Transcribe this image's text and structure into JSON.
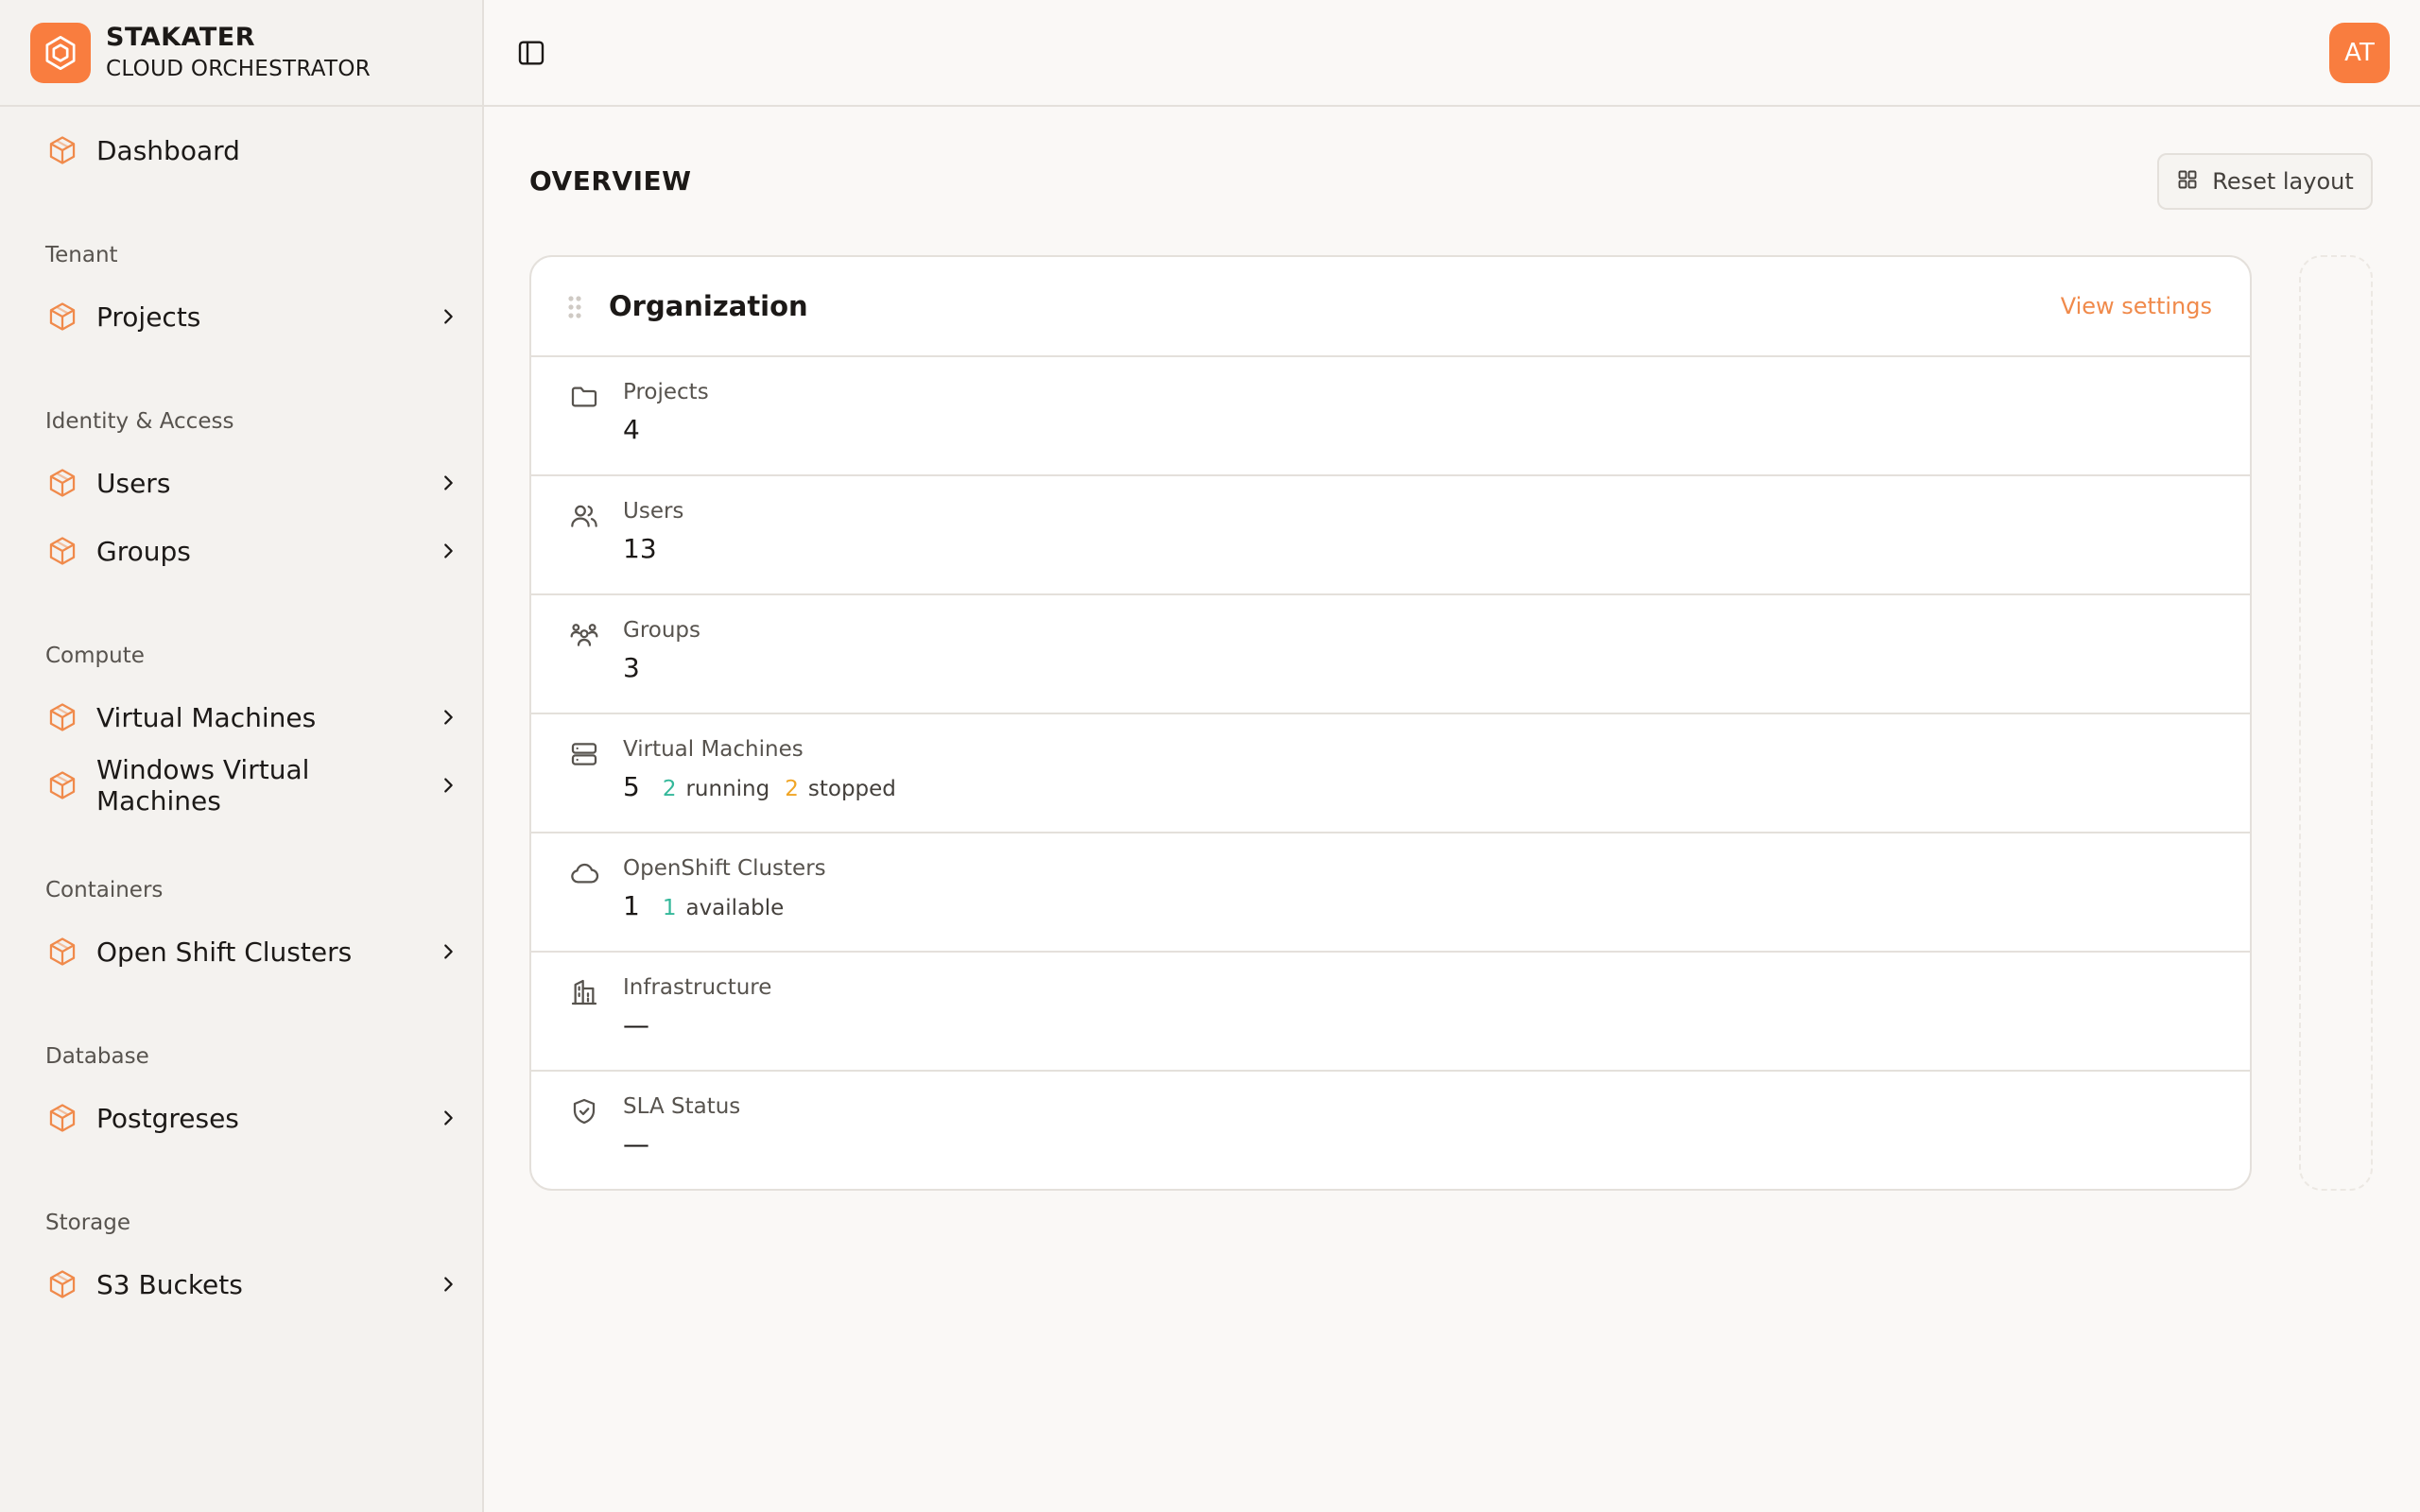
{
  "brand": {
    "name": "STAKATER",
    "subtitle": "CLOUD ORCHESTRATOR"
  },
  "sidebar": {
    "dashboard": "Dashboard",
    "sections": {
      "tenant": "Tenant",
      "identity": "Identity & Access",
      "compute": "Compute",
      "containers": "Containers",
      "database": "Database",
      "storage": "Storage"
    },
    "items": {
      "projects": "Projects",
      "users": "Users",
      "groups": "Groups",
      "virtual_machines": "Virtual Machines",
      "windows_vms": "Windows Virtual Machines",
      "openshift": "Open Shift Clusters",
      "postgreses": "Postgreses",
      "s3": "S3 Buckets"
    }
  },
  "topbar": {
    "avatar_initials": "AT"
  },
  "main": {
    "title": "OVERVIEW",
    "reset_label": "Reset layout",
    "card": {
      "title": "Organization",
      "view_settings": "View settings",
      "rows": {
        "projects": {
          "label": "Projects",
          "value": "4"
        },
        "users": {
          "label": "Users",
          "value": "13"
        },
        "groups": {
          "label": "Groups",
          "value": "3"
        },
        "vms": {
          "label": "Virtual Machines",
          "value": "5",
          "running_count": "2",
          "running_label": "running",
          "stopped_count": "2",
          "stopped_label": "stopped"
        },
        "openshift": {
          "label": "OpenShift Clusters",
          "value": "1",
          "available_count": "1",
          "available_label": "available"
        },
        "infrastructure": {
          "label": "Infrastructure",
          "value": "—"
        },
        "sla": {
          "label": "SLA Status",
          "value": "—"
        }
      }
    }
  },
  "colors": {
    "accent": "#f97d3f",
    "green": "#34b89a",
    "amber": "#f0a526"
  }
}
